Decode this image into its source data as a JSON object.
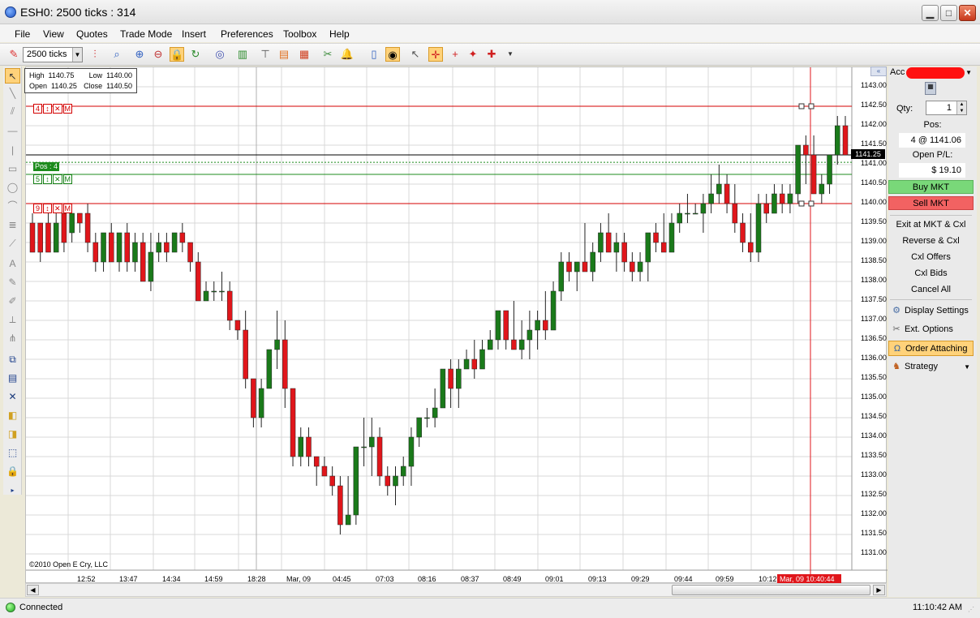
{
  "window": {
    "title": "ESH0: 2500 ticks : 314",
    "minimize": "▁",
    "maximize": "□",
    "close": "✕"
  },
  "menu": [
    "File",
    "View",
    "Quotes",
    "Trade Mode",
    "Insert",
    "Preferences",
    "Toolbox",
    "Help"
  ],
  "toolbar": {
    "interval": "2500 ticks"
  },
  "ohlc": {
    "high_label": "High",
    "high": "1140.75",
    "low_label": "Low",
    "low": "1140.00",
    "open_label": "Open",
    "open": "1140.25",
    "close_label": "Close",
    "close": "1140.50"
  },
  "orders": {
    "stop": {
      "qty": "4",
      "move": "↕",
      "cancel": "✕",
      "mode": "M"
    },
    "position": {
      "label": "Pos : 4"
    },
    "limit_green": {
      "qty": "5",
      "move": "↕",
      "cancel": "✕",
      "mode": "M"
    },
    "limit_red": {
      "qty": "9",
      "move": "↕",
      "cancel": "✕",
      "mode": "M"
    }
  },
  "current_price": "1141.25",
  "copyright": "©2010 Open E Cry, LLC",
  "time_now": "Mar, 09 10:40:44",
  "chart_data": {
    "type": "candlestick",
    "ylim": [
      1130.75,
      1143.25
    ],
    "y_ticks": [
      "1143.00",
      "1142.50",
      "1142.00",
      "1141.50",
      "1141.00",
      "1140.50",
      "1140.00",
      "1139.50",
      "1139.00",
      "1138.50",
      "1138.00",
      "1137.50",
      "1137.00",
      "1136.50",
      "1136.00",
      "1135.50",
      "1135.00",
      "1134.50",
      "1134.00",
      "1133.50",
      "1133.00",
      "1132.50",
      "1132.00",
      "1131.50",
      "1131.00"
    ],
    "x_ticks": [
      "12:52",
      "13:47",
      "14:34",
      "14:59",
      "18:28",
      "Mar, 09",
      "04:45",
      "07:03",
      "08:16",
      "08:37",
      "08:49",
      "09:01",
      "09:13",
      "09:29",
      "09:44",
      "09:59",
      "10:12"
    ],
    "candles": [
      [
        1139.5,
        1139.75,
        1138.75,
        1138.75
      ],
      [
        1139.5,
        1139.5,
        1138.5,
        1138.75
      ],
      [
        1139.5,
        1139.75,
        1138.75,
        1138.75
      ],
      [
        1138.75,
        1139.75,
        1138.75,
        1139.5
      ],
      [
        1139.75,
        1139.75,
        1138.75,
        1139.0
      ],
      [
        1139.25,
        1139.75,
        1139.0,
        1139.75
      ],
      [
        1139.75,
        1139.75,
        1139.25,
        1139.5
      ],
      [
        1139.75,
        1140.0,
        1138.75,
        1139.0
      ],
      [
        1139.0,
        1139.25,
        1138.25,
        1138.5
      ],
      [
        1138.5,
        1139.25,
        1138.25,
        1139.25
      ],
      [
        1139.25,
        1139.5,
        1138.75,
        1138.5
      ],
      [
        1138.5,
        1139.25,
        1138.25,
        1139.25
      ],
      [
        1139.25,
        1139.5,
        1138.25,
        1138.5
      ],
      [
        1138.5,
        1139.25,
        1138.25,
        1139.0
      ],
      [
        1139.0,
        1139.25,
        1138.0,
        1138.0
      ],
      [
        1138.0,
        1139.25,
        1137.75,
        1138.75
      ],
      [
        1138.75,
        1139.25,
        1138.5,
        1139.0
      ],
      [
        1139.0,
        1139.25,
        1138.5,
        1138.75
      ],
      [
        1138.75,
        1139.25,
        1138.75,
        1139.25
      ],
      [
        1139.25,
        1139.5,
        1138.75,
        1139.0
      ],
      [
        1139.0,
        1139.0,
        1138.25,
        1138.5
      ],
      [
        1138.5,
        1138.75,
        1137.75,
        1137.5
      ],
      [
        1137.5,
        1138.0,
        1137.5,
        1137.75
      ],
      [
        1137.75,
        1138.0,
        1137.5,
        1137.75
      ],
      [
        1137.75,
        1138.25,
        1137.5,
        1137.75
      ],
      [
        1137.75,
        1138.0,
        1136.75,
        1137.0
      ],
      [
        1137.0,
        1137.0,
        1136.5,
        1136.75
      ],
      [
        1136.75,
        1137.25,
        1135.25,
        1135.5
      ],
      [
        1135.5,
        1135.5,
        1134.25,
        1134.5
      ],
      [
        1134.5,
        1135.5,
        1134.25,
        1135.25
      ],
      [
        1135.25,
        1136.25,
        1135.25,
        1136.25
      ],
      [
        1136.25,
        1137.25,
        1135.75,
        1136.5
      ],
      [
        1136.5,
        1137.0,
        1134.75,
        1135.25
      ],
      [
        1135.25,
        1135.25,
        1133.25,
        1133.5
      ],
      [
        1133.5,
        1134.25,
        1133.25,
        1134.0
      ],
      [
        1134.0,
        1134.25,
        1133.25,
        1133.5
      ],
      [
        1133.5,
        1133.5,
        1132.75,
        1133.25
      ],
      [
        1133.25,
        1133.5,
        1133.0,
        1133.0
      ],
      [
        1133.0,
        1133.25,
        1132.5,
        1132.75
      ],
      [
        1132.75,
        1133.0,
        1131.5,
        1131.75
      ],
      [
        1131.75,
        1133.0,
        1131.75,
        1132.0
      ],
      [
        1132.0,
        1133.75,
        1131.75,
        1133.75
      ],
      [
        1133.75,
        1134.5,
        1133.25,
        1133.75
      ],
      [
        1133.75,
        1134.5,
        1133.0,
        1134.0
      ],
      [
        1134.0,
        1134.25,
        1132.75,
        1133.0
      ],
      [
        1133.0,
        1133.25,
        1132.5,
        1132.75
      ],
      [
        1132.75,
        1133.25,
        1132.25,
        1133.0
      ],
      [
        1133.0,
        1133.5,
        1132.75,
        1133.25
      ],
      [
        1133.25,
        1134.25,
        1132.75,
        1134.0
      ],
      [
        1134.0,
        1134.5,
        1133.75,
        1134.5
      ],
      [
        1134.5,
        1134.75,
        1134.25,
        1134.5
      ],
      [
        1134.5,
        1135.25,
        1134.25,
        1134.75
      ],
      [
        1134.75,
        1135.75,
        1134.75,
        1135.75
      ],
      [
        1135.75,
        1136.0,
        1134.75,
        1135.25
      ],
      [
        1135.25,
        1136.0,
        1134.75,
        1135.75
      ],
      [
        1135.75,
        1136.25,
        1135.75,
        1136.0
      ],
      [
        1136.0,
        1136.5,
        1135.5,
        1135.75
      ],
      [
        1135.75,
        1136.5,
        1135.75,
        1136.25
      ],
      [
        1136.25,
        1136.75,
        1136.25,
        1136.5
      ],
      [
        1136.5,
        1137.25,
        1136.25,
        1137.25
      ],
      [
        1137.25,
        1137.25,
        1136.25,
        1136.5
      ],
      [
        1136.5,
        1137.5,
        1136.25,
        1136.25
      ],
      [
        1136.25,
        1137.0,
        1136.0,
        1136.5
      ],
      [
        1136.5,
        1137.25,
        1136.0,
        1136.75
      ],
      [
        1136.75,
        1137.25,
        1136.25,
        1137.0
      ],
      [
        1137.0,
        1137.75,
        1136.5,
        1136.75
      ],
      [
        1136.75,
        1138.0,
        1136.75,
        1137.75
      ],
      [
        1137.75,
        1138.75,
        1137.5,
        1138.5
      ],
      [
        1138.5,
        1138.75,
        1138.0,
        1138.25
      ],
      [
        1138.25,
        1138.5,
        1137.75,
        1138.5
      ],
      [
        1138.5,
        1139.5,
        1138.25,
        1138.25
      ],
      [
        1138.25,
        1139.0,
        1138.0,
        1138.75
      ],
      [
        1138.75,
        1139.5,
        1138.5,
        1139.25
      ],
      [
        1139.25,
        1139.75,
        1138.75,
        1138.75
      ],
      [
        1138.75,
        1139.25,
        1138.25,
        1139.0
      ],
      [
        1139.0,
        1139.25,
        1138.25,
        1138.5
      ],
      [
        1138.5,
        1138.75,
        1138.0,
        1138.25
      ],
      [
        1138.25,
        1138.75,
        1138.0,
        1138.5
      ],
      [
        1138.5,
        1139.25,
        1138.0,
        1139.25
      ],
      [
        1139.25,
        1139.5,
        1138.75,
        1139.0
      ],
      [
        1139.0,
        1139.75,
        1139.0,
        1138.75
      ],
      [
        1138.75,
        1139.75,
        1138.75,
        1139.5
      ],
      [
        1139.5,
        1140.0,
        1139.25,
        1139.75
      ],
      [
        1139.75,
        1140.25,
        1139.5,
        1139.75
      ],
      [
        1139.75,
        1140.0,
        1139.75,
        1139.75
      ],
      [
        1139.75,
        1140.25,
        1139.25,
        1140.0
      ],
      [
        1140.0,
        1140.75,
        1139.75,
        1140.25
      ],
      [
        1140.25,
        1141.0,
        1140.0,
        1140.5
      ],
      [
        1140.5,
        1140.75,
        1139.75,
        1140.0
      ],
      [
        1140.0,
        1140.5,
        1139.25,
        1139.5
      ],
      [
        1139.5,
        1139.75,
        1138.75,
        1139.0
      ],
      [
        1139.0,
        1139.75,
        1138.5,
        1138.75
      ],
      [
        1138.75,
        1140.25,
        1138.5,
        1140.0
      ],
      [
        1140.0,
        1140.25,
        1139.5,
        1139.75
      ],
      [
        1139.75,
        1140.5,
        1139.75,
        1140.25
      ],
      [
        1140.25,
        1140.5,
        1139.75,
        1140.0
      ],
      [
        1140.0,
        1140.5,
        1139.75,
        1140.25
      ],
      [
        1140.25,
        1141.5,
        1140.0,
        1141.5
      ],
      [
        1141.5,
        1141.75,
        1140.5,
        1141.25
      ],
      [
        1141.25,
        1141.75,
        1140.25,
        1140.25
      ],
      [
        1140.25,
        1140.75,
        1140.0,
        1140.5
      ],
      [
        1140.5,
        1141.25,
        1140.25,
        1141.25
      ],
      [
        1141.25,
        1142.25,
        1141.0,
        1142.0
      ],
      [
        1142.0,
        1142.25,
        1141.25,
        1141.25
      ]
    ]
  },
  "panel": {
    "account_label": "Acc",
    "qty_label": "Qty:",
    "qty_value": "1",
    "pos_label": "Pos:",
    "pos_value": "4 @ 1141.06",
    "pl_label": "Open P/L:",
    "pl_value": "$ 19.10",
    "buy": "Buy MKT",
    "sell": "Sell MKT",
    "links": [
      "Exit at MKT & Cxl",
      "Reverse & Cxl",
      "Cxl Offers",
      "Cxl Bids",
      "Cancel All"
    ],
    "display_settings": "Display Settings",
    "ext_options": "Ext. Options",
    "order_attaching": "Order Attaching",
    "strategy": "Strategy"
  },
  "status": {
    "connection": "Connected",
    "clock": "11:10:42 AM"
  },
  "colors": {
    "up": "#1a7a1a",
    "down": "#e0161b",
    "grid": "#d9d9d9",
    "buy": "#79d879",
    "sell": "#f26262"
  }
}
